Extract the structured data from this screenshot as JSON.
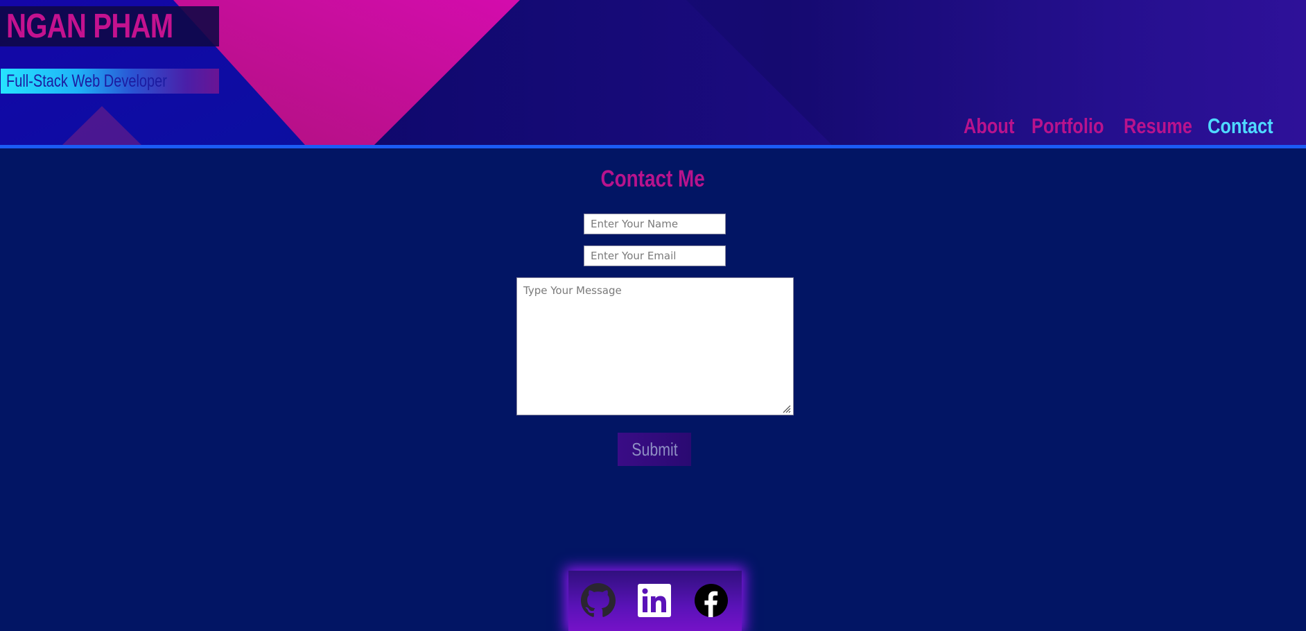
{
  "header": {
    "name": "NGAN PHAM",
    "tagline": "Full-Stack Web Developer"
  },
  "nav": {
    "items": [
      {
        "label": "About",
        "active": false
      },
      {
        "label": "Portfolio",
        "active": false
      },
      {
        "label": "Resume",
        "active": false
      },
      {
        "label": "Contact",
        "active": true
      }
    ]
  },
  "contact": {
    "title": "Contact Me",
    "name_placeholder": "Enter Your Name",
    "email_placeholder": "Enter Your Email",
    "message_placeholder": "Type Your Message",
    "submit_label": "Submit"
  },
  "footer": {
    "icons": [
      "github-icon",
      "linkedin-icon",
      "facebook-icon"
    ]
  },
  "colors": {
    "background": "#021564",
    "accent_magenta": "#b8138d",
    "accent_cyan": "#4fd9ff",
    "header_rule": "#1b5cf5",
    "footer_glow": "#8a17e8"
  }
}
